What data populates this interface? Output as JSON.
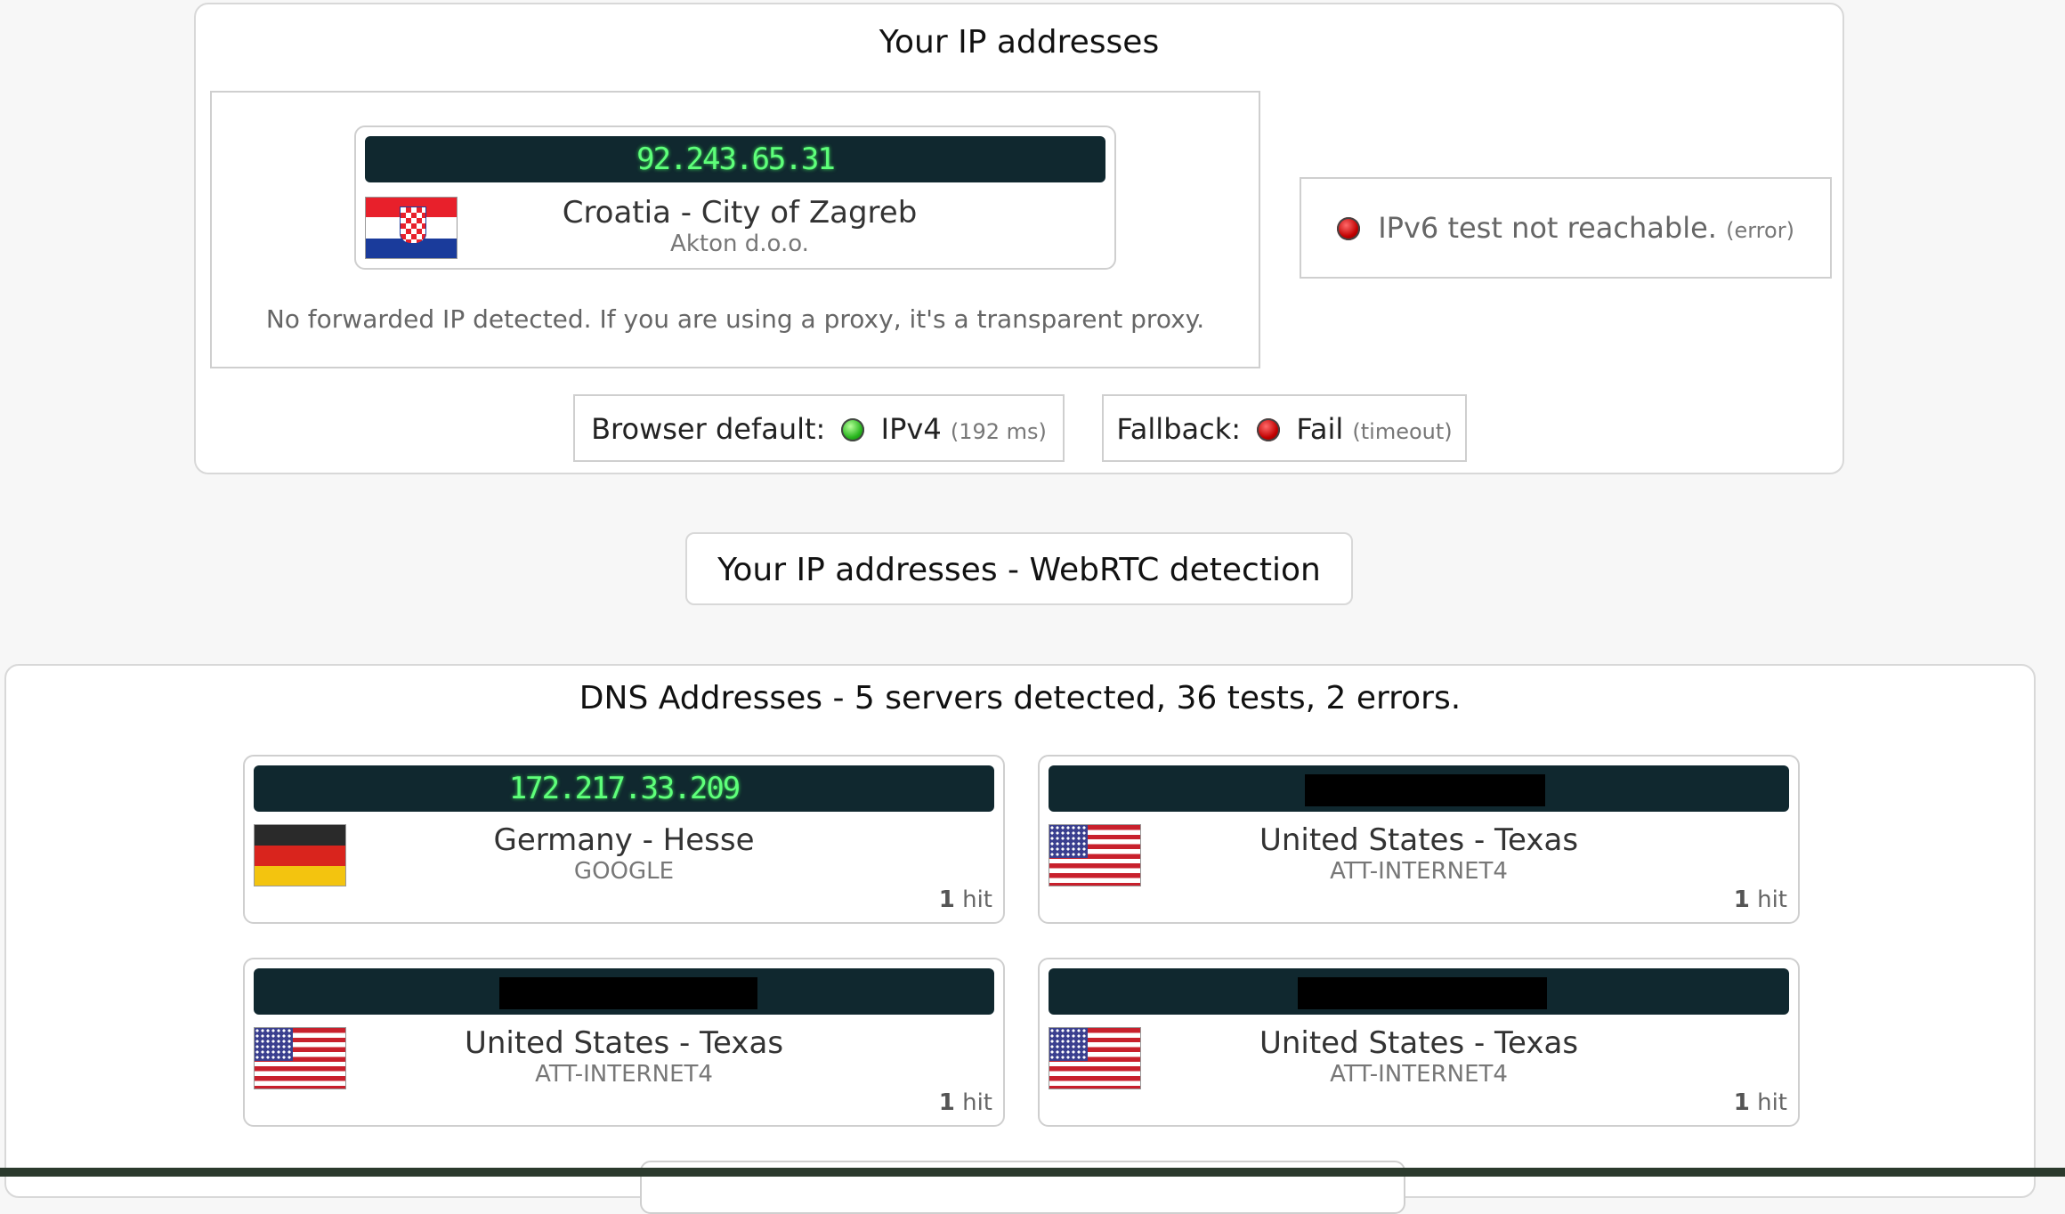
{
  "ip_panel": {
    "title": "Your IP addresses",
    "ipv4": {
      "ip": "92.243.65.31",
      "location": "Croatia - City of Zagreb",
      "isp": "Akton d.o.o.",
      "flag": "croatia-flag"
    },
    "forward_note": "No forwarded IP detected. If you are using a proxy, it's a transparent proxy.",
    "ipv6": {
      "text": "IPv6 test not reachable.",
      "note": "(error)",
      "status_color": "#c10000"
    },
    "browser_default": {
      "label": "Browser default:",
      "value": "IPv4",
      "note": "(192 ms)",
      "status_color": "#27b51d"
    },
    "fallback": {
      "label": "Fallback:",
      "value": "Fail",
      "note": "(timeout)",
      "status_color": "#c10000"
    }
  },
  "webrtc": {
    "title": "Your IP addresses - WebRTC detection"
  },
  "dns": {
    "title": "DNS Addresses - 5 servers detected, 36 tests, 2 errors.",
    "hit_suffix": "hit",
    "servers": [
      {
        "ip": "172.217.33.209",
        "location": "Germany - Hesse",
        "isp": "GOOGLE",
        "hits": "1",
        "flag": "germany-flag"
      },
      {
        "ip": "",
        "location": "United States - Texas",
        "isp": "ATT-INTERNET4",
        "hits": "1",
        "flag": "usa-flag"
      },
      {
        "ip": "",
        "location": "United States - Texas",
        "isp": "ATT-INTERNET4",
        "hits": "1",
        "flag": "usa-flag"
      },
      {
        "ip": "",
        "location": "United States - Texas",
        "isp": "ATT-INTERNET4",
        "hits": "1",
        "flag": "usa-flag"
      }
    ]
  }
}
